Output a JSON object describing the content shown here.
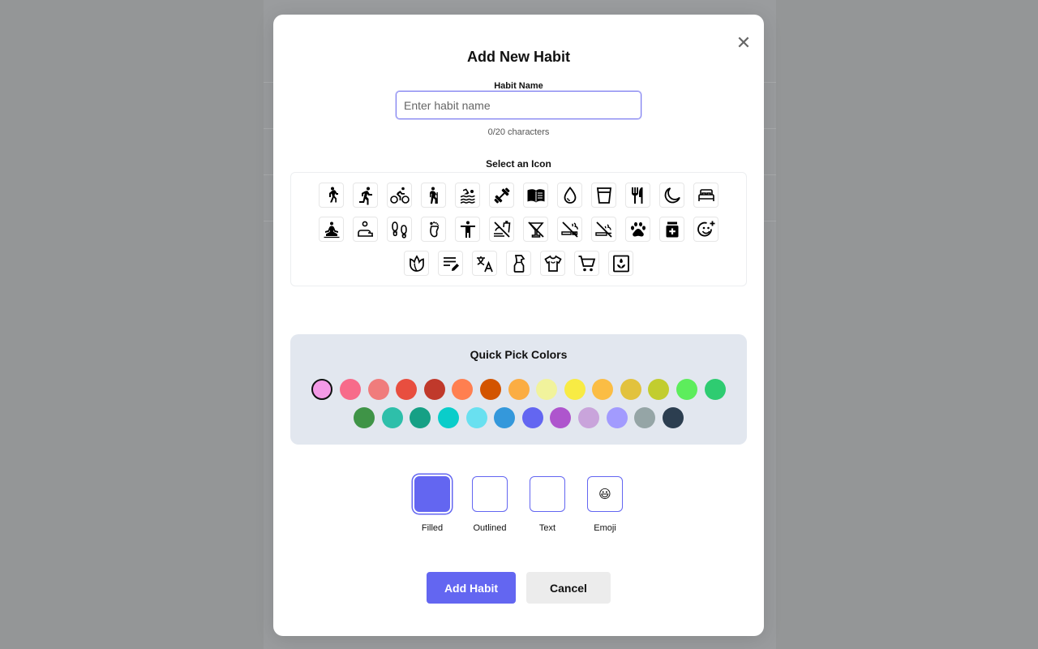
{
  "modal": {
    "title": "Add New Habit",
    "close_glyph": "✕"
  },
  "habit_name": {
    "label": "Habit Name",
    "placeholder": "Enter habit name",
    "value": "",
    "char_count": "0/20 characters"
  },
  "icons": {
    "label": "Select an Icon",
    "items": [
      "walking-icon",
      "running-icon",
      "cycling-icon",
      "hiking-icon",
      "swimming-icon",
      "dumbbell-icon",
      "book-icon",
      "water-drop-icon",
      "glass-icon",
      "utensils-icon",
      "moon-icon",
      "bed-icon",
      "meditation-icon",
      "lying-person-icon",
      "footprints-icon",
      "foot-icon",
      "stretching-person-icon",
      "no-food-icon",
      "no-alcohol-icon",
      "no-smoking-icon",
      "no-vaping-icon",
      "paw-icon",
      "medication-icon",
      "add-emoji-icon",
      "tulip-icon",
      "notes-icon",
      "translate-icon",
      "spray-bottle-icon",
      "shirt-icon",
      "shopping-cart-icon",
      "plant-frame-icon"
    ]
  },
  "colors": {
    "title": "Quick Pick Colors",
    "selected": "#f49ae6",
    "row1": [
      "#f49ae6",
      "#f76b8a",
      "#f07c7c",
      "#e84e3f",
      "#c0392b",
      "#ff7f50",
      "#d35400",
      "#fbad43",
      "#f1f39c",
      "#f8eb44",
      "#fbbd44",
      "#e2c23d",
      "#c2cd2f",
      "#5ded5c",
      "#2ecc71"
    ],
    "row2": [
      "#3f9447",
      "#2ebfaa",
      "#16a085",
      "#0acdca",
      "#69e0f0",
      "#3498db",
      "#6366f1",
      "#ae55cd",
      "#c9a4db",
      "#a29bfe",
      "#95a5a6",
      "#2c3e50"
    ]
  },
  "styles": {
    "options": [
      {
        "label": "Filled",
        "content": ""
      },
      {
        "label": "Outlined",
        "content": ""
      },
      {
        "label": "Text",
        "content": ""
      },
      {
        "label": "Emoji",
        "content": "😃"
      }
    ],
    "selected": "Filled",
    "accent": "#6366f1"
  },
  "actions": {
    "add_label": "Add Habit",
    "cancel_label": "Cancel"
  }
}
